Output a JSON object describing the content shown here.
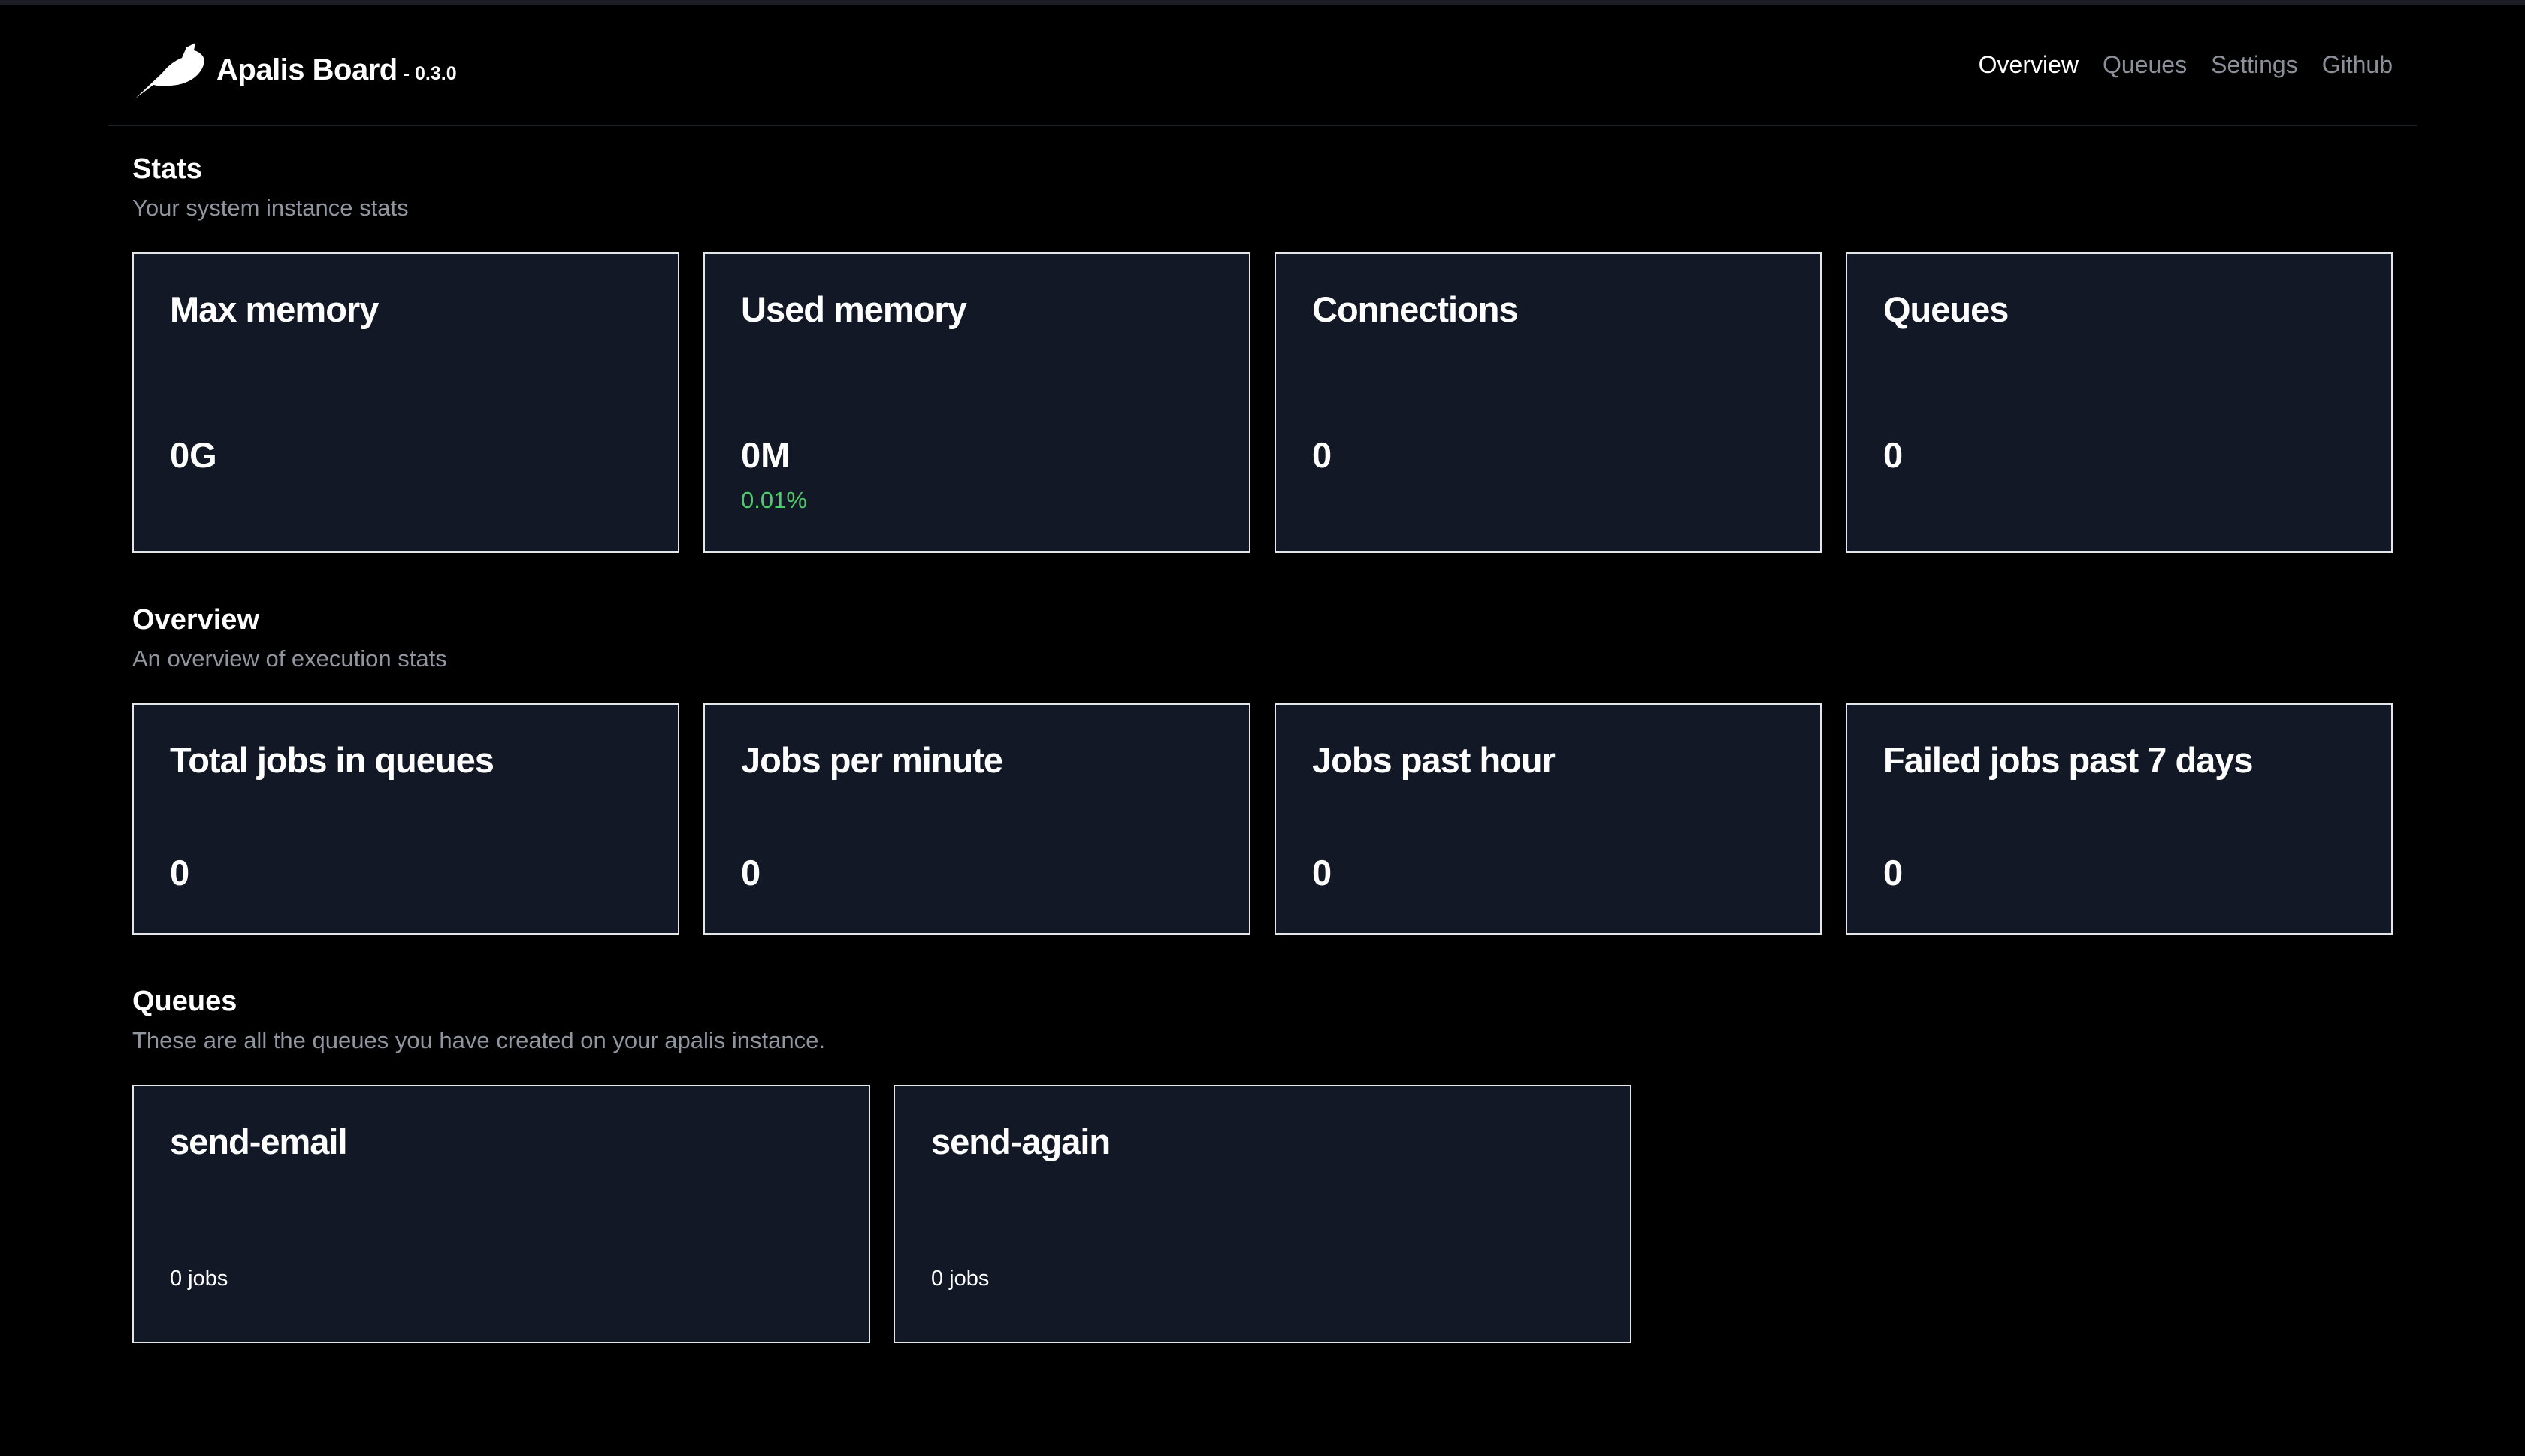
{
  "header": {
    "brand_name": "Apalis Board",
    "brand_version": "- 0.3.0",
    "logo_icon": "bird-icon",
    "nav": [
      {
        "label": "Overview",
        "active": true
      },
      {
        "label": "Queues",
        "active": false
      },
      {
        "label": "Settings",
        "active": false
      },
      {
        "label": "Github",
        "active": false
      }
    ]
  },
  "stats": {
    "title": "Stats",
    "subtitle": "Your system instance stats",
    "cards": [
      {
        "title": "Max memory",
        "value": "0G"
      },
      {
        "title": "Used memory",
        "value": "0M",
        "sub": "0.01%"
      },
      {
        "title": "Connections",
        "value": "0"
      },
      {
        "title": "Queues",
        "value": "0"
      }
    ]
  },
  "overview": {
    "title": "Overview",
    "subtitle": "An overview of execution stats",
    "cards": [
      {
        "title": "Total jobs in queues",
        "value": "0"
      },
      {
        "title": "Jobs per minute",
        "value": "0"
      },
      {
        "title": "Jobs past hour",
        "value": "0"
      },
      {
        "title": "Failed jobs past 7 days",
        "value": "0"
      }
    ]
  },
  "queues": {
    "title": "Queues",
    "subtitle": "These are all the queues you have created on your apalis instance.",
    "items": [
      {
        "name": "send-email",
        "jobs": "0 jobs"
      },
      {
        "name": "send-again",
        "jobs": "0 jobs"
      }
    ]
  },
  "colors": {
    "background": "#000000",
    "card": "#131826",
    "card_border": "#e4e6ea",
    "accent_green": "#4ecb6a",
    "nav_inactive": "#8b8f99"
  }
}
